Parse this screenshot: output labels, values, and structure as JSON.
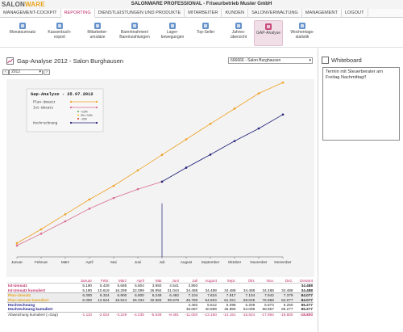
{
  "logo": {
    "part1": "SALON",
    "part2": "WARE"
  },
  "app_title": "SALONWARE PROFESSIONAL - Friseurbetrieb Muster GmbH",
  "menu": [
    {
      "label": "MANAGEMENT-COCKPIT",
      "active": false
    },
    {
      "label": "REPORTING",
      "active": true
    },
    {
      "label": "DIENSTLEISTUNGEN UND PRODUKTE",
      "active": false
    },
    {
      "label": "MITARBEITER",
      "active": false
    },
    {
      "label": "KUNDEN",
      "active": false
    },
    {
      "label": "SALONVERWALTUNG",
      "active": false
    },
    {
      "label": "MANAGEMENT",
      "active": false
    },
    {
      "label": "LOGOUT",
      "active": false
    }
  ],
  "toolbar": [
    {
      "label": "Monatsumsatz",
      "icon": "monthly-revenue-icon"
    },
    {
      "label": "Kassenbuch-\nexport",
      "icon": "cashbook-export-icon"
    },
    {
      "label": "Mitarbeiter-\numsätze",
      "icon": "employee-revenue-icon"
    },
    {
      "label": "Barentnahmen/\nBareinzahlungen",
      "icon": "cash-withdrawals-icon"
    },
    {
      "label": "Lager-\nbewegungen",
      "icon": "stock-movements-icon"
    },
    {
      "label": "Top-Seller",
      "icon": "top-seller-icon"
    },
    {
      "label": "Jahres-\nübersicht",
      "icon": "annual-overview-icon"
    },
    {
      "label": "GAP-Analyse",
      "icon": "gap-analysis-icon",
      "active": true
    },
    {
      "label": "Wochentags-\nstatistik",
      "icon": "weekday-statistics-icon"
    }
  ],
  "page": {
    "title": "Gap-Analyse 2012 - Salon Burghausen",
    "salon_select": "666666 - Salon Burghausen",
    "year_select": "2012",
    "prev": "‹",
    "next": "›"
  },
  "whiteboard": {
    "title": "Whiteboard",
    "text": "Termin mit Steuerberater am Freitag Nachmittag!!"
  },
  "chart_data": {
    "type": "line",
    "title": "Gap-Analyse - 25.07.2012",
    "categories": [
      "Januar",
      "Februar",
      "März",
      "April",
      "Mai",
      "Juni",
      "Juli",
      "August",
      "September",
      "Oktober",
      "November",
      "Dezember"
    ],
    "ylim": [
      0,
      80000
    ],
    "marker_month": "Juli",
    "series": [
      {
        "name": "Plan-Umsatz",
        "color": "#f0a020",
        "values": [
          6300,
          12624,
          19524,
          26334,
          32583,
          39678,
          46780,
          53880,
          60984,
          67980,
          74948,
          79887
        ]
      },
      {
        "name": "Ist-Umsatz",
        "color": "#d86a8a",
        "values": [
          5190,
          10619,
          16299,
          22099,
          26994,
          31044,
          34488,
          null,
          null,
          null,
          null,
          null
        ]
      },
      {
        "name": "Hochrechnung",
        "color": "#1c1c78",
        "values": [
          null,
          null,
          null,
          null,
          null,
          null,
          34488,
          40899,
          46890,
          53099,
          58867,
          65277
        ]
      }
    ],
    "legend_extra": [
      "+10%",
      "0%-+10%",
      "-10%"
    ]
  },
  "table": {
    "header_label": "",
    "months": [
      "Januar",
      "Febr.",
      "März",
      "April",
      "Mai",
      "Juni",
      "Juli",
      "August",
      "Sept.",
      "Okt.",
      "Nov.",
      "Dez.",
      "Gesamt"
    ],
    "rows": [
      {
        "label": "Ist-Umsatz",
        "cls": "ist",
        "values": [
          "5.190",
          "5.429",
          "5.685",
          "5.804",
          "3.950",
          "4.541",
          "3.893",
          "",
          "",
          "",
          "",
          "",
          "34.488"
        ]
      },
      {
        "label": "Ist-Umsatz kumuliert",
        "cls": "ist",
        "values": [
          "5.190",
          "10.619",
          "16.299",
          "22.099",
          "26.994",
          "31.044",
          "34.488",
          "34.488",
          "34.488",
          "34.488",
          "34.488",
          "34.488",
          "34.488"
        ]
      },
      {
        "label": "Plan-Umsatz",
        "cls": "plan shade group-top",
        "values": [
          "6.300",
          "6.324",
          "6.900",
          "6.800",
          "6.249",
          "6.492",
          "7.104",
          "7.824",
          "7.917",
          "7.104",
          "7.942",
          "7.379",
          "84.077"
        ]
      },
      {
        "label": "Plan-Umsatz kumuliert",
        "cls": "plan shade",
        "values": [
          "6.300",
          "12.624",
          "19.524",
          "26.334",
          "32.583",
          "39.678",
          "46.780",
          "54.604",
          "61.021",
          "69.025",
          "76.968",
          "84.077",
          "84.077"
        ]
      },
      {
        "label": "Hochrechnung",
        "cls": "hoch group-top",
        "values": [
          "",
          "",
          "",
          "",
          "",
          "",
          "4.492",
          "5.812",
          "6.099",
          "6.209",
          "5.873",
          "6.250",
          "65.277"
        ]
      },
      {
        "label": "Hochrechnung kumuliert",
        "cls": "hoch",
        "values": [
          "",
          "",
          "",
          "",
          "",
          "",
          "35.087",
          "40.899",
          "46.890",
          "53.099",
          "58.867",
          "65.277",
          "65.277"
        ]
      },
      {
        "label": "Abweichung kumuliert (=Gap)",
        "cls": "abw group-top",
        "values": [
          "-1.110",
          "-2.024",
          "-3.229",
          "-4.235",
          "-5.629",
          "-8.491",
          "-11.093",
          "-13.150",
          "-14.191",
          "-15.824",
          "-17.894",
          "-18.800",
          "-18.800"
        ]
      }
    ]
  }
}
